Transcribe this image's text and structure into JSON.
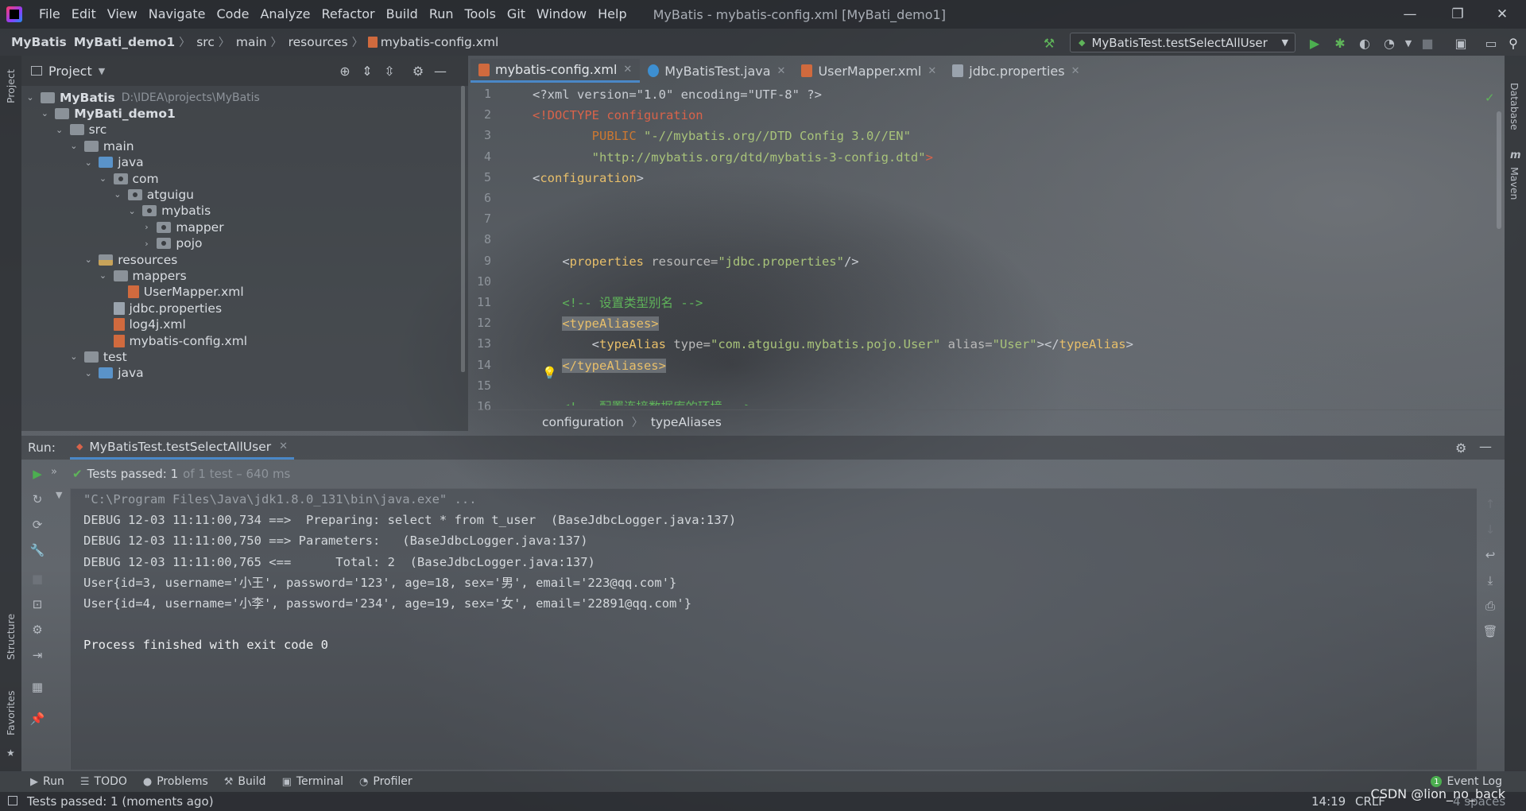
{
  "window": {
    "title": "MyBatis - mybatis-config.xml [MyBati_demo1]",
    "minimize": "—",
    "restore": "❐",
    "close": "✕"
  },
  "menu": [
    "File",
    "Edit",
    "View",
    "Navigate",
    "Code",
    "Analyze",
    "Refactor",
    "Build",
    "Run",
    "Tools",
    "Git",
    "Window",
    "Help"
  ],
  "breadcrumbs": [
    "MyBatis",
    "MyBati_demo1",
    "src",
    "main",
    "resources",
    "mybatis-config.xml"
  ],
  "run_config": {
    "label": "MyBatisTest.testSelectAllUser"
  },
  "left_stripe": {
    "project": "Project",
    "structure": "Structure",
    "favorites": "Favorites"
  },
  "right_stripe": {
    "database": "Database",
    "maven": "Maven"
  },
  "project_panel": {
    "title": "Project",
    "tree": [
      {
        "name": "MyBatis",
        "sub": "D:\\IDEA\\projects\\MyBatis",
        "kind": "plain",
        "level": 0,
        "open": true,
        "bold": true
      },
      {
        "name": "MyBati_demo1",
        "kind": "plain",
        "level": 1,
        "open": true,
        "bold": true
      },
      {
        "name": "src",
        "kind": "plain",
        "level": 2,
        "open": true
      },
      {
        "name": "main",
        "kind": "plain",
        "level": 3,
        "open": true
      },
      {
        "name": "java",
        "kind": "src",
        "level": 4,
        "open": true
      },
      {
        "name": "com",
        "kind": "pkg",
        "level": 5,
        "open": true
      },
      {
        "name": "atguigu",
        "kind": "pkg",
        "level": 6,
        "open": true
      },
      {
        "name": "mybatis",
        "kind": "pkg",
        "level": 7,
        "open": true
      },
      {
        "name": "mapper",
        "kind": "pkg",
        "level": 8,
        "open": false
      },
      {
        "name": "pojo",
        "kind": "pkg",
        "level": 8,
        "open": false
      },
      {
        "name": "resources",
        "kind": "res",
        "level": 4,
        "open": true
      },
      {
        "name": "mappers",
        "kind": "plain",
        "level": 5,
        "open": true
      },
      {
        "name": "UserMapper.xml",
        "kind": "xml",
        "level": 6
      },
      {
        "name": "jdbc.properties",
        "kind": "props",
        "level": 5
      },
      {
        "name": "log4j.xml",
        "kind": "xml",
        "level": 5
      },
      {
        "name": "mybatis-config.xml",
        "kind": "xml",
        "level": 5
      },
      {
        "name": "test",
        "kind": "plain",
        "level": 3,
        "open": true
      },
      {
        "name": "java",
        "kind": "src",
        "level": 4,
        "open": true
      }
    ]
  },
  "editor": {
    "tabs": [
      {
        "label": "mybatis-config.xml",
        "icon": "xml",
        "active": true
      },
      {
        "label": "MyBatisTest.java",
        "icon": "java",
        "active": false
      },
      {
        "label": "UserMapper.xml",
        "icon": "xml",
        "active": false
      },
      {
        "label": "jdbc.properties",
        "icon": "props",
        "active": false
      }
    ],
    "line_numbers": [
      "1",
      "2",
      "3",
      "4",
      "5",
      "6",
      "7",
      "8",
      "9",
      "10",
      "11",
      "12",
      "13",
      "14",
      "15",
      "16"
    ],
    "code": [
      [
        [
          "dim",
          "<?xml version=\"1.0\" encoding=\"UTF-8\" ?>"
        ]
      ],
      [
        [
          "doc",
          "<!DOCTYPE configuration"
        ]
      ],
      [
        [
          "dim",
          "        "
        ],
        [
          "kw",
          "PUBLIC "
        ],
        [
          "str",
          "\"-//mybatis.org//DTD Config 3.0//EN\""
        ]
      ],
      [
        [
          "dim",
          "        "
        ],
        [
          "str",
          "\"http://mybatis.org/dtd/mybatis-3-config.dtd\""
        ],
        [
          "doc",
          ">"
        ]
      ],
      [
        [
          "dim",
          "<"
        ],
        [
          "tag",
          "configuration"
        ],
        [
          "dim",
          ">"
        ]
      ],
      [],
      [],
      [],
      [
        [
          "dim",
          "    <"
        ],
        [
          "tag",
          "properties "
        ],
        [
          "attr",
          "resource="
        ],
        [
          "str",
          "\"jdbc.properties\""
        ],
        [
          "dim",
          "/>"
        ]
      ],
      [],
      [
        [
          "dim",
          "    "
        ],
        [
          "cmt",
          "<!-- 设置类型别名 -->"
        ]
      ],
      [
        [
          "dim",
          "    "
        ],
        [
          "hl",
          "<typeAliases>"
        ]
      ],
      [
        [
          "dim",
          "        <"
        ],
        [
          "tag",
          "typeAlias "
        ],
        [
          "attr",
          "type="
        ],
        [
          "str",
          "\"com.atguigu.mybatis.pojo.User\" "
        ],
        [
          "attr",
          "alias="
        ],
        [
          "str",
          "\"User\""
        ],
        [
          "dim",
          "></"
        ],
        [
          "tag",
          "typeAlias"
        ],
        [
          "dim",
          ">"
        ]
      ],
      [
        [
          "dim",
          "    "
        ],
        [
          "hl",
          "</typeAliases>"
        ]
      ],
      [],
      [
        [
          "dim",
          "    "
        ],
        [
          "cmt",
          "<!-- 配置连接数据库的环境 -->"
        ]
      ]
    ],
    "breadcrumb": [
      "configuration",
      "typeAliases"
    ]
  },
  "run_panel": {
    "label": "Run:",
    "tab": "MyBatisTest.testSelectAllUser",
    "tests_passed": "Tests passed: 1",
    "tests_detail": "of 1 test – 640 ms",
    "console": [
      {
        "text": "\"C:\\Program Files\\Java\\jdk1.8.0_131\\bin\\java.exe\" ...",
        "style": "cmd"
      },
      {
        "text": "DEBUG 12-03 11:11:00,734 ==>  Preparing: select * from t_user  (BaseJdbcLogger.java:137)",
        "style": "out"
      },
      {
        "text": "DEBUG 12-03 11:11:00,750 ==> Parameters:   (BaseJdbcLogger.java:137)",
        "style": "out"
      },
      {
        "text": "DEBUG 12-03 11:11:00,765 <==      Total: 2  (BaseJdbcLogger.java:137)",
        "style": "out"
      },
      {
        "text": "User{id=3, username='小王', password='123', age=18, sex='男', email='223@qq.com'}",
        "style": "out"
      },
      {
        "text": "User{id=4, username='小李', password='234', age=19, sex='女', email='22891@qq.com'}",
        "style": "out"
      },
      {
        "text": "",
        "style": "out"
      },
      {
        "text": "Process finished with exit code 0",
        "style": "bright"
      }
    ]
  },
  "tool_windows": [
    "Run",
    "TODO",
    "Problems",
    "Build",
    "Terminal",
    "Profiler"
  ],
  "event_log": {
    "label": "Event Log",
    "count": "1"
  },
  "status_bar": {
    "message": "Tests passed: 1 (moments ago)",
    "position": "14:19",
    "line_sep": "CRLF",
    "indent": "4 spaces"
  },
  "watermark": "CSDN @lion_no_back",
  "colors": {
    "accent": "#4a88c7",
    "run_green": "#4caf50",
    "test_pass": "#5fb45a"
  }
}
